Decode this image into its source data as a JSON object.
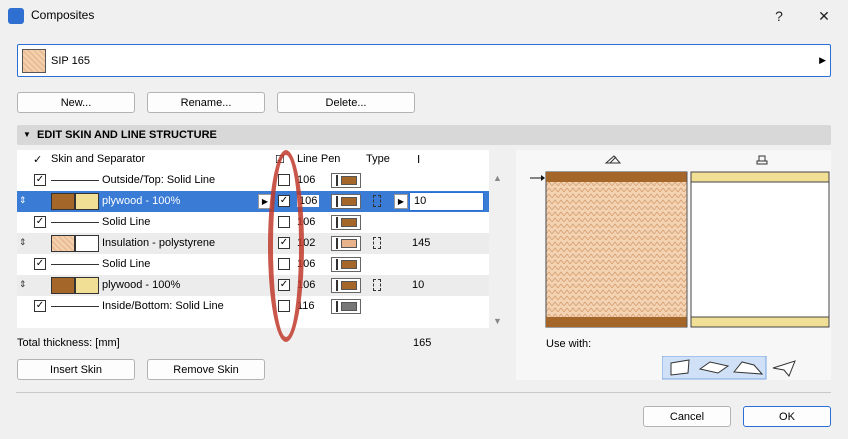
{
  "window": {
    "title": "Composites",
    "help_label": "?",
    "close_label": "✕"
  },
  "composite": {
    "name": "SIP 165"
  },
  "buttons": {
    "new": "New...",
    "rename": "Rename...",
    "delete": "Delete...",
    "insert_skin": "Insert Skin",
    "remove_skin": "Remove Skin",
    "cancel": "Cancel",
    "ok": "OK"
  },
  "section": {
    "title": "EDIT SKIN AND LINE STRUCTURE"
  },
  "table": {
    "headers": {
      "skin": "Skin and Separator",
      "line_pen": "Line Pen",
      "type": "Type"
    },
    "rows": [
      {
        "kind": "line",
        "label": "Outside/Top: Solid Line",
        "checked": true,
        "pen": "106",
        "pen_color": "#a5662a"
      },
      {
        "kind": "skin",
        "label": "plywood - 100%",
        "checked": true,
        "pen": "106",
        "pen_color": "#a5662a",
        "thickness": "10",
        "selected": true
      },
      {
        "kind": "line",
        "label": "Solid Line",
        "checked": true,
        "pen": "106",
        "pen_color": "#a5662a"
      },
      {
        "kind": "skin",
        "label": "Insulation - polystyrene",
        "checked": true,
        "pen": "102",
        "pen_color": "#e8b38a",
        "thickness": "145",
        "insulation": true
      },
      {
        "kind": "line",
        "label": "Solid Line",
        "checked": true,
        "pen": "106",
        "pen_color": "#a5662a"
      },
      {
        "kind": "skin",
        "label": "plywood - 100%",
        "checked": true,
        "pen": "106",
        "pen_color": "#a5662a",
        "thickness": "10"
      },
      {
        "kind": "line",
        "label": "Inside/Bottom: Solid Line",
        "checked": true,
        "pen": "116",
        "pen_color": "#777777"
      }
    ]
  },
  "total": {
    "label": "Total thickness: [mm]",
    "value": "165"
  },
  "use_with": {
    "label": "Use with:"
  },
  "colors": {
    "accent": "#2a6fd6",
    "plywood": "#a5662a",
    "plywood_light": "#f2df96",
    "selection": "#3a7bd5",
    "annotation": "#c0392b"
  }
}
